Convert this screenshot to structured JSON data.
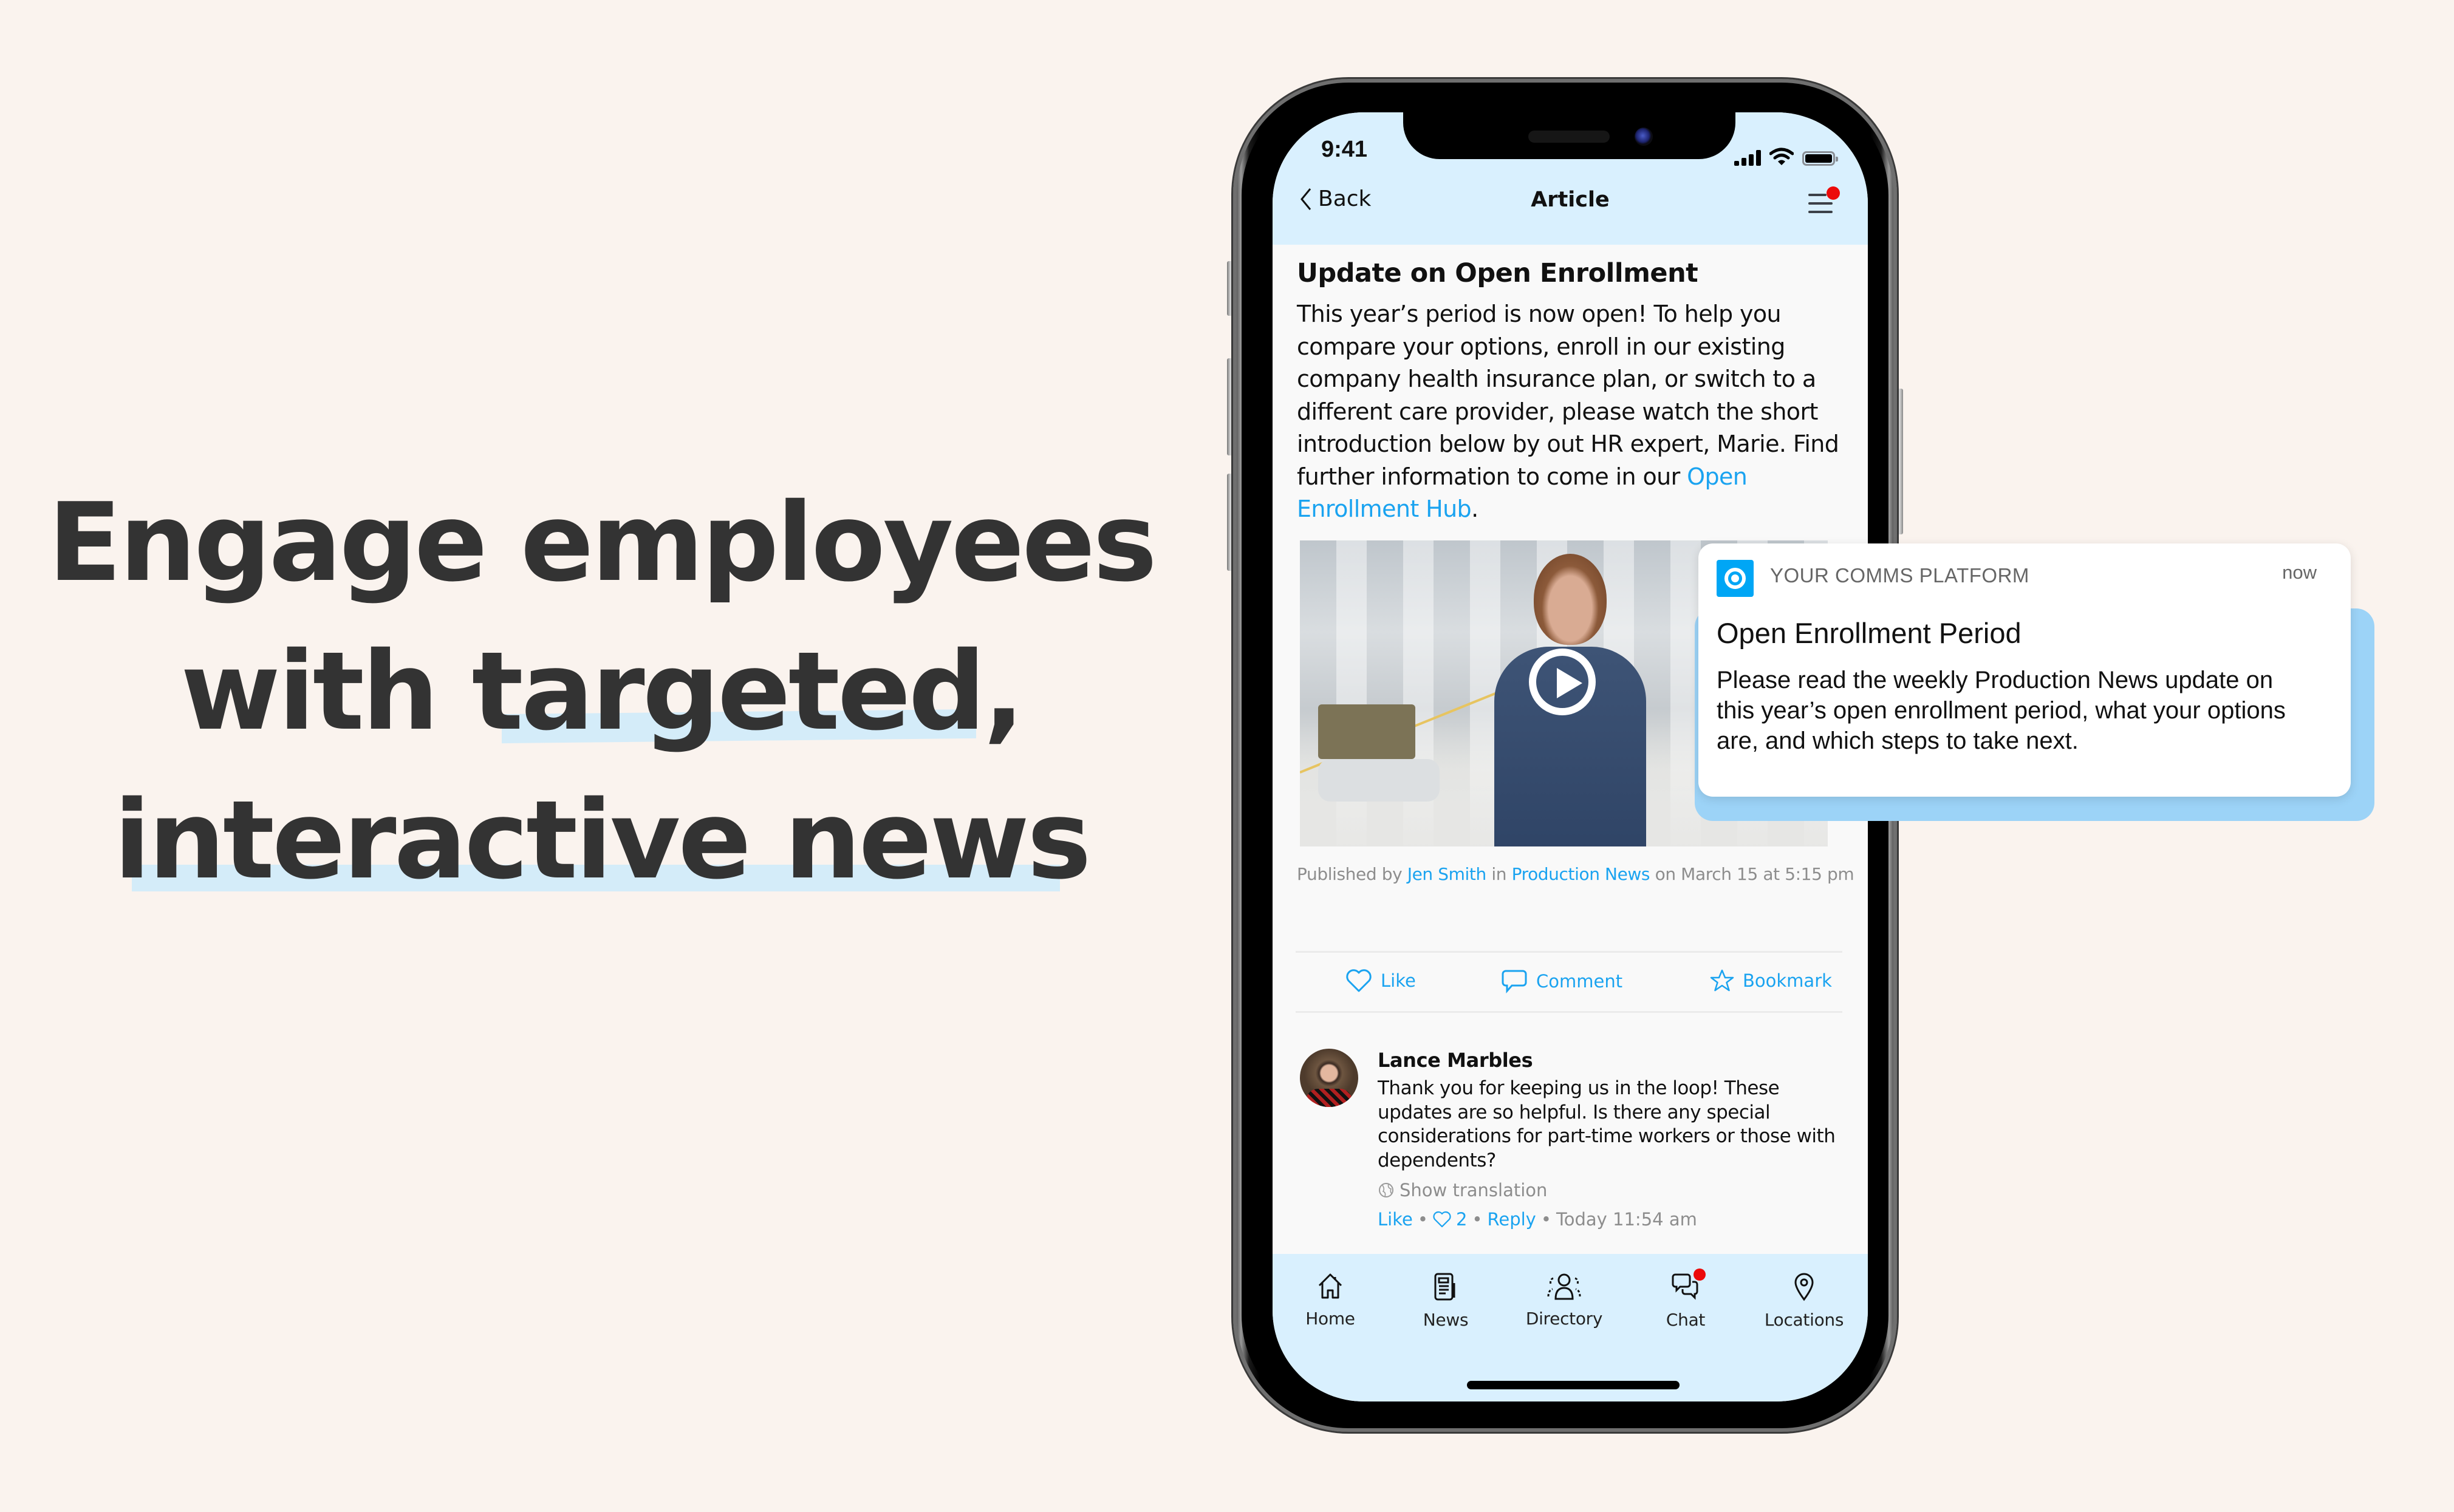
{
  "headline": {
    "line1": "Engage employees",
    "line2_pre": "with ",
    "line2_highlight": "targeted,",
    "line3_highlight": "interactive news",
    "highlight_color": "#D4ECF9",
    "text_color": "#333333"
  },
  "status_bar": {
    "time": "9:41"
  },
  "nav": {
    "back_label": "Back",
    "title": "Article",
    "menu_has_badge": true
  },
  "article": {
    "title": "Update on Open Enrollment",
    "body": "This year’s period is now open! To help you compare your options, enroll in our existing company health insurance plan, or switch to a different care provider, please watch the short introduction below by out HR expert, Marie. Find further information to come in our ",
    "link_text": "Open Enrollment Hub",
    "body_end": ".",
    "video_icon": "play-icon",
    "byline": {
      "prefix": "Published by ",
      "author": "Jen Smith",
      "mid": " in ",
      "channel": "Production News",
      "suffix": " on March 15 at 5:15 pm"
    }
  },
  "actions": [
    {
      "label": "Like",
      "icon": "heart-icon"
    },
    {
      "label": "Comment",
      "icon": "comment-icon"
    },
    {
      "label": "Bookmark",
      "icon": "star-icon"
    }
  ],
  "comment": {
    "author": "Lance Marbles",
    "text": "Thank you for keeping us in the loop! These updates are so helpful. Is there any special considerations for  part-time workers or those with dependents?",
    "translate_label": "Show translation",
    "like_label": "Like",
    "like_count": "2",
    "reply_label": "Reply",
    "timestamp": "Today 11:54 am",
    "separator": "•"
  },
  "tabs": [
    {
      "label": "Home",
      "icon": "home-icon"
    },
    {
      "label": "News",
      "icon": "news-icon"
    },
    {
      "label": "Directory",
      "icon": "directory-icon"
    },
    {
      "label": "Chat",
      "icon": "chat-icon",
      "badge": true
    },
    {
      "label": "Locations",
      "icon": "location-pin-icon"
    }
  ],
  "notification": {
    "app_name": "YOUR COMMS PLATFORM",
    "time": "now",
    "title": "Open Enrollment Period",
    "body": "Please read the weekly Production News update on this year’s open enrollment period, what your options are, and which steps to take next.",
    "accent_color": "#00A6F5"
  },
  "colors": {
    "background": "#FAF3EE",
    "app_header": "#D9F0FE",
    "link": "#1AA3F0",
    "badge": "#EC0A0A"
  }
}
